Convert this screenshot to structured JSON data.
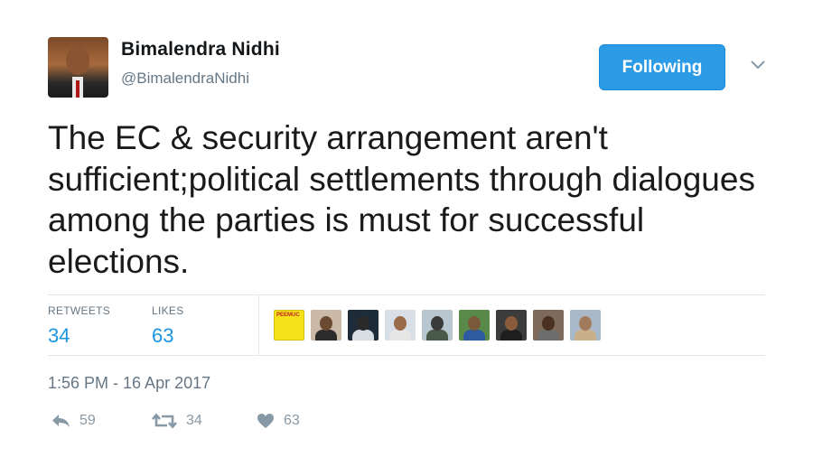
{
  "author": {
    "name": "Bimalendra Nidhi",
    "handle": "@BimalendraNidhi",
    "avatar_icon": "profile-photo"
  },
  "follow_button": {
    "label": "Following",
    "color": "#2b9be6"
  },
  "menu": {
    "icon": "chevron-down-icon"
  },
  "tweet": {
    "text": "The EC & security arrangement aren't sufficient;political settlements through dialogues among the parties is must for successful elections."
  },
  "stats": {
    "retweets": {
      "label": "RETWEETS",
      "count": "34"
    },
    "likes": {
      "label": "LIKES",
      "count": "63"
    }
  },
  "likers": [
    {
      "kind": "logo",
      "text": "PEEMUC"
    },
    {
      "kind": "photo",
      "bg": "#c9b9a6",
      "head": "#6b4a32",
      "body": "#2b2b2b"
    },
    {
      "kind": "photo",
      "bg": "#1e2b39",
      "head": "#2a2a2a",
      "body": "#d8dde3"
    },
    {
      "kind": "photo",
      "bg": "#d9dfe6",
      "head": "#9a6a4a",
      "body": "#e6e6e6"
    },
    {
      "kind": "photo",
      "bg": "#b9c6cf",
      "head": "#3a3a3a",
      "body": "#4a5a4a"
    },
    {
      "kind": "photo",
      "bg": "#5a8a4a",
      "head": "#7a5a3a",
      "body": "#2e5aa0"
    },
    {
      "kind": "photo",
      "bg": "#3c3c3c",
      "head": "#8a5c3c",
      "body": "#1e1e1e"
    },
    {
      "kind": "photo",
      "bg": "#7d6a5a",
      "head": "#4a3020",
      "body": "#6d6d6d"
    },
    {
      "kind": "photo",
      "bg": "#a9b9c9",
      "head": "#a07a5a",
      "body": "#c9b08a"
    }
  ],
  "timestamp": "1:56 PM - 16 Apr 2017",
  "actions": {
    "reply": {
      "icon": "reply-icon",
      "count": "59"
    },
    "retweet": {
      "icon": "retweet-icon",
      "count": "34"
    },
    "like": {
      "icon": "heart-icon",
      "count": "63"
    }
  }
}
